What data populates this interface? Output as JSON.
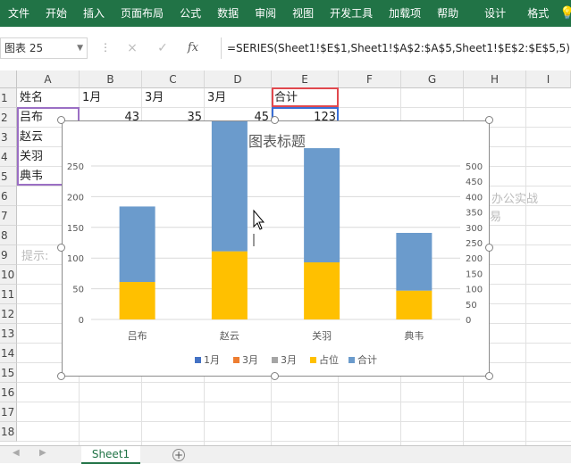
{
  "ribbon": {
    "tabs": [
      "文件",
      "开始",
      "插入",
      "页面布局",
      "公式",
      "数据",
      "审阅",
      "视图",
      "开发工具",
      "加载项",
      "帮助"
    ],
    "context_tabs": [
      "设计",
      "格式"
    ],
    "bg_color": "#217346"
  },
  "namebox": {
    "value": "图表 25"
  },
  "formula_bar": {
    "cancel_icon": "×",
    "enter_icon": "✓",
    "fx_icon": "fx",
    "formula": "=SERIES(Sheet1!$E$1,Sheet1!$A$2:$A$5,Sheet1!$E$2:$E$5,5)"
  },
  "columns": [
    "A",
    "B",
    "C",
    "D",
    "E",
    "F",
    "G",
    "H",
    "I"
  ],
  "rows": [
    "1",
    "2",
    "3",
    "4",
    "5",
    "6",
    "7",
    "8",
    "9",
    "10",
    "11",
    "12",
    "13",
    "14",
    "15",
    "16",
    "17",
    "18"
  ],
  "cells": {
    "A1": "姓名",
    "B1": "1月",
    "C1": "3月",
    "D1": "3月",
    "E1": "合计",
    "A2": "吕布",
    "B2": "43",
    "C2": "35",
    "D2": "45",
    "E2": "123",
    "A3": "赵云",
    "A4": "关羽",
    "A5": "典韦"
  },
  "hint_text": "提示:",
  "side_text_1": "办公实战",
  "side_text_2": "易",
  "chart_data": {
    "type": "bar",
    "stacked": true,
    "title": "图表标题",
    "categories": [
      "吕布",
      "赵云",
      "关羽",
      "典韦"
    ],
    "series": [
      {
        "name": "1月",
        "values": [
          0,
          0,
          0,
          0
        ],
        "color": "#4472c4"
      },
      {
        "name": "3月",
        "values": [
          0,
          0,
          0,
          0
        ],
        "color": "#ed7d31"
      },
      {
        "name": "3月",
        "values": [
          0,
          0,
          0,
          0
        ],
        "color": "#a5a5a5"
      },
      {
        "name": "占位",
        "values": [
          61,
          111,
          93,
          47
        ],
        "color": "#ffc000"
      },
      {
        "name": "合计",
        "values": [
          123,
          222,
          186,
          94
        ],
        "color": "#6b9bcc"
      }
    ],
    "ylim": [
      0,
      250
    ],
    "y_ticks": [
      0,
      50,
      100,
      150,
      200,
      250
    ],
    "y2lim": [
      0,
      500
    ],
    "y2_ticks": [
      0,
      50,
      100,
      150,
      200,
      250,
      300,
      350,
      400,
      450,
      500
    ],
    "legend_position": "bottom",
    "grid": true
  },
  "sheet_tab": "Sheet1",
  "add_sheet_icon": "+"
}
